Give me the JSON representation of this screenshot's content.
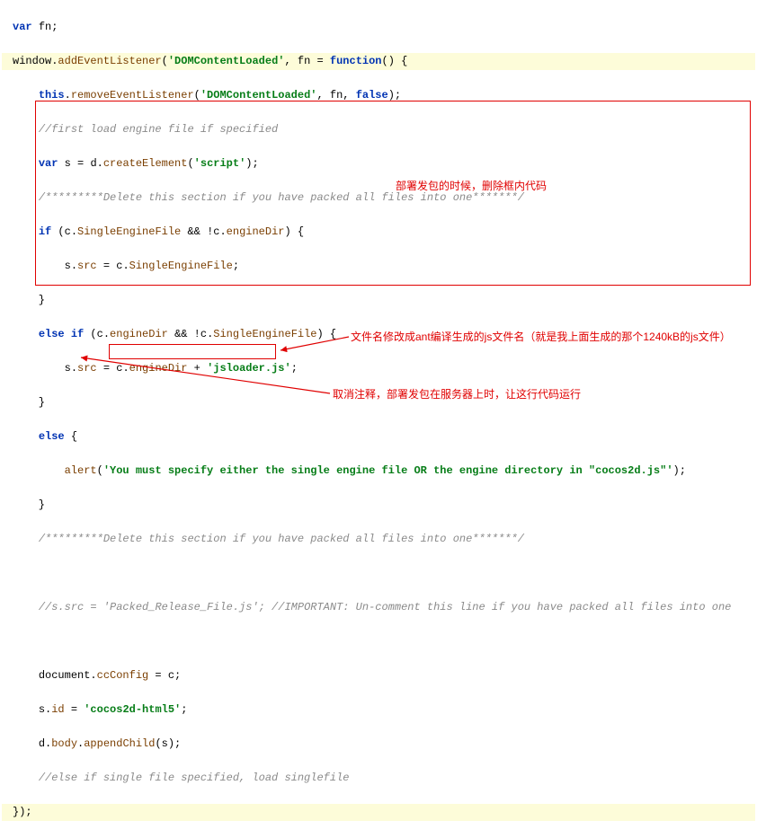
{
  "code": {
    "l1_kw_var": "var",
    "l1_id": "fn",
    "l2_win": "window",
    "l2_add": "addEventListener",
    "l2_str": "'DOMContentLoaded'",
    "l2_fn": "fn",
    "l2_func": "function",
    "l3_this": "this",
    "l3_rem": "removeEventListener",
    "l3_str": "'DOMContentLoaded'",
    "l3_fn": "fn",
    "l3_false": "false",
    "l4_cm": "//first load engine file if specified",
    "l5_var": "var",
    "l5_s": "s",
    "l5_d": "d",
    "l5_create": "createElement",
    "l5_str": "'script'",
    "l6_cm": "/*********Delete this section if you have packed all files into one*******/",
    "l7_if": "if",
    "l7_c": "c",
    "l7_single": "SingleEngineFile",
    "l7_and": "&&",
    "l7_not": "!",
    "l7_c2": "c",
    "l7_enginedir": "engineDir",
    "l8_s": "s",
    "l8_src": "src",
    "l8_c": "c",
    "l8_single": "SingleEngineFile",
    "l10_elseif": "else if",
    "l10_c": "c",
    "l10_enginedir": "engineDir",
    "l10_and": "&&",
    "l10_not": "!",
    "l10_c2": "c",
    "l10_single": "SingleEngineFile",
    "l11_s": "s",
    "l11_src": "src",
    "l11_c": "c",
    "l11_enginedir": "engineDir",
    "l11_plus": "+",
    "l11_str": "'jsloader.js'",
    "l13_else": "else",
    "l14_alert": "alert",
    "l14_str": "'You must specify either the single engine file OR the engine directory in \"cocos2d.js\"'",
    "l16_cm": "/*********Delete this section if you have packed all files into one*******/",
    "l18_cm1": "//s.src = ",
    "l18_cm2": "'Packed_Release_File.js'",
    "l18_cm3": "; //IMPORTANT: Un-comment this line if you have packed all files into one",
    "l20_doc": "document",
    "l20_ccconfig": "ccConfig",
    "l20_c": "c",
    "l21_s": "s",
    "l21_id": "id",
    "l21_str": "'cocos2d-html5'",
    "l22_d": "d",
    "l22_body": "body",
    "l22_append": "appendChild",
    "l22_s2": "s",
    "l23_cm": "//else if single file specified, load singlefile"
  },
  "annot": {
    "a1": "部署发包的时候，删除框内代码",
    "a2": "文件名修改成ant编译生成的js文件名（就是我上面生成的那个1240kB的js文件）",
    "a3": "取消注释，部署发包在服务器上时，让这行代码运行"
  }
}
